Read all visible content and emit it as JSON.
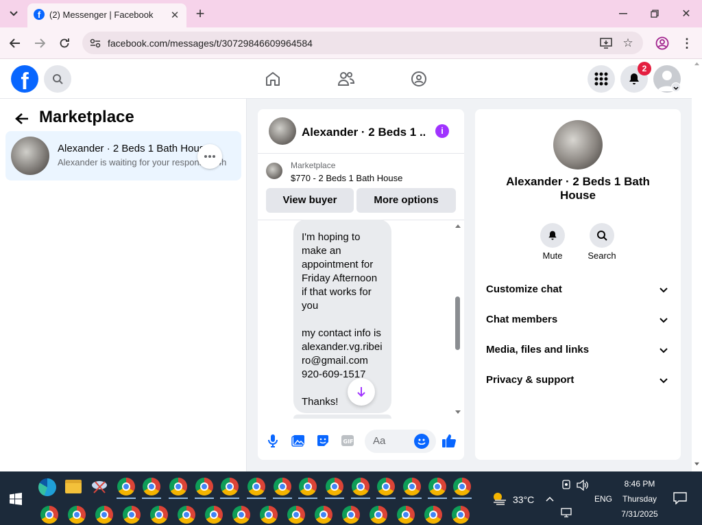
{
  "browser": {
    "tab_title": "(2) Messenger | Facebook",
    "url": "facebook.com/messages/t/30729846609964584"
  },
  "header": {
    "notification_count": "2"
  },
  "left_panel": {
    "title": "Marketplace",
    "conversation": {
      "name": "Alexander · 2 Beds 1 Bath House",
      "preview": "Alexander is waiting for your response · 4h"
    }
  },
  "chat": {
    "title": "Alexander · 2 Beds 1 ...",
    "marketplace_label": "Marketplace",
    "listing": "$770 - 2 Beds 1 Bath House",
    "view_buyer": "View buyer",
    "more_options": "More options",
    "message_lines": [
      "I'm hoping to",
      "make an",
      "appointment for",
      "Friday Afternoon",
      "if that works for",
      "you",
      "",
      "my contact info is",
      "alexander.vg.ribei",
      "ro@gmail.com",
      "920-609-1517",
      "",
      "Thanks!"
    ],
    "composer_placeholder": "Aa"
  },
  "details": {
    "name": "Alexander · 2 Beds 1 Bath House",
    "mute": "Mute",
    "search": "Search",
    "sections": [
      "Customize chat",
      "Chat members",
      "Media, files and links",
      "Privacy & support"
    ]
  },
  "taskbar": {
    "temperature": "33°C",
    "language": "ENG",
    "time": "8:46 PM",
    "day": "Thursday",
    "date": "7/31/2025"
  },
  "colors": {
    "facebook_blue": "#0866ff",
    "messenger_purple": "#a033ff",
    "badge_red": "#e41e3f"
  }
}
